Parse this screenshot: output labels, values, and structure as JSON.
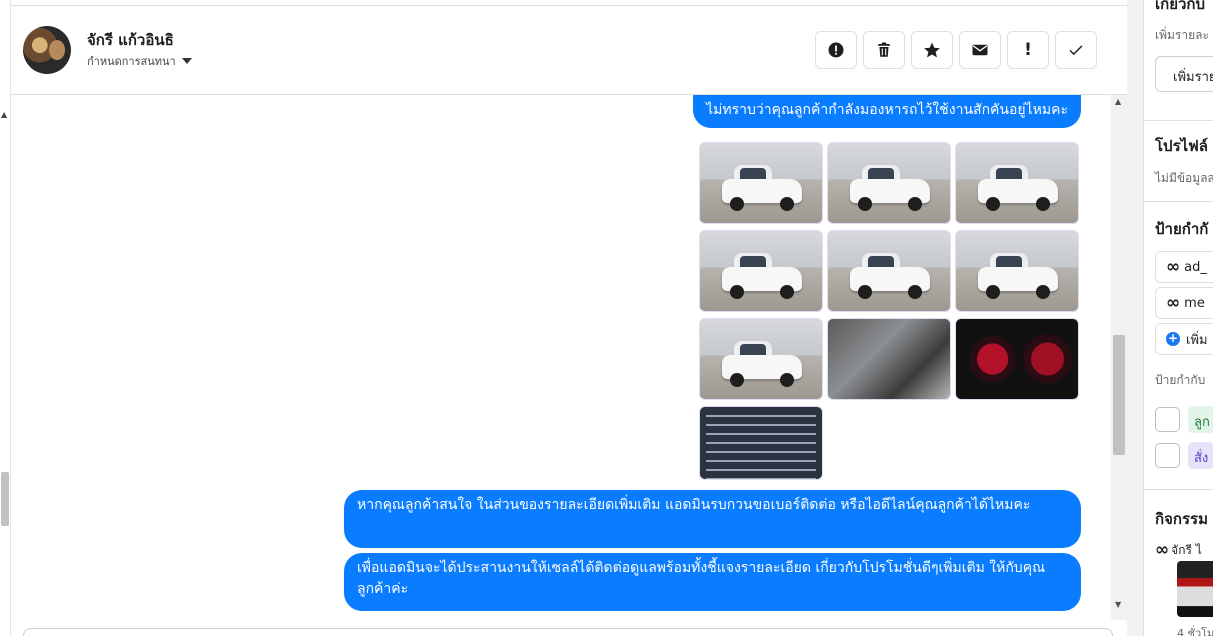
{
  "header": {
    "contact_name": "จักรี แก้วอินธิ",
    "assign_label": "กำหนดการสนทนา"
  },
  "actions": [
    {
      "name": "spam-button",
      "icon": "exclamation-circle-icon"
    },
    {
      "name": "delete-button",
      "icon": "trash-icon"
    },
    {
      "name": "star-button",
      "icon": "star-icon"
    },
    {
      "name": "mark-unread-button",
      "icon": "envelope-icon"
    },
    {
      "name": "follow-up-button",
      "icon": "exclamation-icon",
      "glyph": "!"
    },
    {
      "name": "mark-done-button",
      "icon": "checkmark-icon"
    }
  ],
  "messages": [
    {
      "text": "ไม่ทราบว่าคุณลูกค้ากำลังมองหารถไว้ใช้งานสักคันอยู่ไหมคะ"
    },
    {
      "text": "หากคุณลูกค้าสนใจ ในส่วนของรายละเอียดเพิ่มเติม แอดมินรบกวนขอเบอร์ติดต่อ หรือไอดีไลน์คุณลูกค้าได้ไหมคะ"
    },
    {
      "text": "เพื่อแอดมินจะได้ประสานงานให้เซลล์ได้ติดต่อดูแลพร้อมทั้งชี้แจงรายละเอียด เกี่ยวกับโปรโมชั่นดีๆเพิ่มเติม ให้กับคุณลูกค้าค่ะ"
    }
  ],
  "photos": [
    {
      "subject": "white pickup front-left view"
    },
    {
      "subject": "white pickup front view"
    },
    {
      "subject": "white pickup rear-left view"
    },
    {
      "subject": "white pickup rear view"
    },
    {
      "subject": "white pickup front-right view"
    },
    {
      "subject": "white pickup side view"
    },
    {
      "subject": "white pickup side view wide"
    },
    {
      "subject": "interior seats"
    },
    {
      "subject": "dashboard gauges"
    },
    {
      "subject": "vehicle info document"
    }
  ],
  "right_panel": {
    "section1_title": "เกี่ยวกับ",
    "section1_sub": "เพิ่มรายละ",
    "section1_button": "เพิ่มราย",
    "profile_title": "โปรไฟล์",
    "profile_sub": "ไม่มีข้อมูลส",
    "labels_title": "ป้ายกำกั",
    "tags": [
      {
        "icon": "meta-icon",
        "text": "ad_"
      },
      {
        "icon": "meta-icon",
        "text": "me"
      }
    ],
    "add_tag_label": "เพิ่ม",
    "labels_sub": "ป้ายกำกับ",
    "checks": [
      {
        "text": "ลูก",
        "color": "green"
      },
      {
        "text": "สั่ง",
        "color": "purple"
      }
    ],
    "activity_title": "กิจกรรม",
    "activity_text": "จักรี ไ",
    "activity_foot": "4 ชั่วโม"
  }
}
